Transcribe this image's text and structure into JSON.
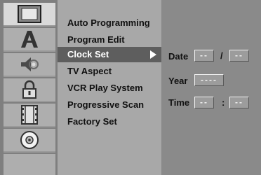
{
  "sidebar": {
    "icons": [
      {
        "name": "tv-screen-icon",
        "active": true
      },
      {
        "name": "language-font-icon",
        "active": false
      },
      {
        "name": "audio-speaker-icon",
        "active": false
      },
      {
        "name": "padlock-icon",
        "active": false
      },
      {
        "name": "film-strip-icon",
        "active": false
      },
      {
        "name": "disc-icon",
        "active": false
      }
    ]
  },
  "menu": {
    "items": [
      {
        "label": "Auto Programming"
      },
      {
        "label": "Program Edit"
      },
      {
        "label": "Clock Set",
        "selected": true
      },
      {
        "label": "TV Aspect"
      },
      {
        "label": "VCR Play System"
      },
      {
        "label": "Progressive Scan"
      },
      {
        "label": "Factory Set"
      }
    ]
  },
  "clock": {
    "date_label": "Date",
    "date_month": "--",
    "date_separator": "/",
    "date_day": "--",
    "year_label": "Year",
    "year_value": "----",
    "time_label": "Time",
    "time_hour": "--",
    "time_separator": ":",
    "time_minute": "--"
  },
  "colors": {
    "selected_row": "#5e5e5e",
    "active_icon_tile": "#d9d9d9",
    "field_text": "#f2f2f2"
  }
}
